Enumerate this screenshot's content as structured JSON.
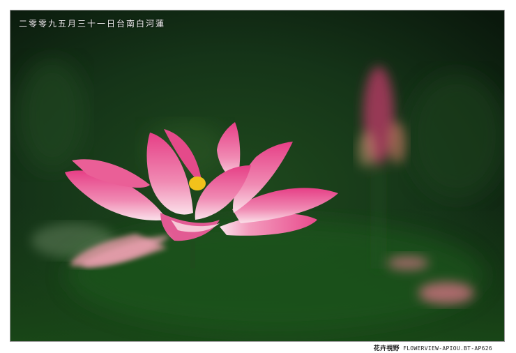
{
  "photo": {
    "caption": "二零零九五月三十一日台南白河蓮",
    "subject": "lotus-flower"
  },
  "footer": {
    "brand": "花卉視野",
    "url": "FLOWERVIEW-APIOU.BT-AP626"
  },
  "colors": {
    "background": "#0d1f10",
    "petal": "#e8528f",
    "petal_light": "#f7c6d8",
    "stamen": "#f2c21b"
  }
}
